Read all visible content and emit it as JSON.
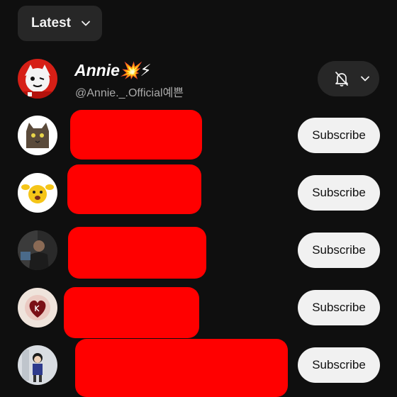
{
  "sort": {
    "label": "Latest",
    "icon": "chevron-down-icon"
  },
  "featured_channel": {
    "name": "Annie💥⚡",
    "handle": "@Annie._.Official예쁜",
    "notification_icon": "bell-off-icon",
    "menu_icon": "chevron-down-icon"
  },
  "channels": [
    {
      "subscribe_label": "Subscribe",
      "avatar": "cat-avatar"
    },
    {
      "subscribe_label": "Subscribe",
      "avatar": "emoji-avatar"
    },
    {
      "subscribe_label": "Subscribe",
      "avatar": "photo-avatar"
    },
    {
      "subscribe_label": "Subscribe",
      "avatar": "heart-avatar"
    },
    {
      "subscribe_label": "Subscribe",
      "avatar": "figure-avatar"
    }
  ],
  "colors": {
    "background": "#0f0f0f",
    "chip": "#272727",
    "subscribe_bg": "#f1f1f1",
    "redaction": "#ff0000",
    "handle_text": "#aaaaaa"
  }
}
